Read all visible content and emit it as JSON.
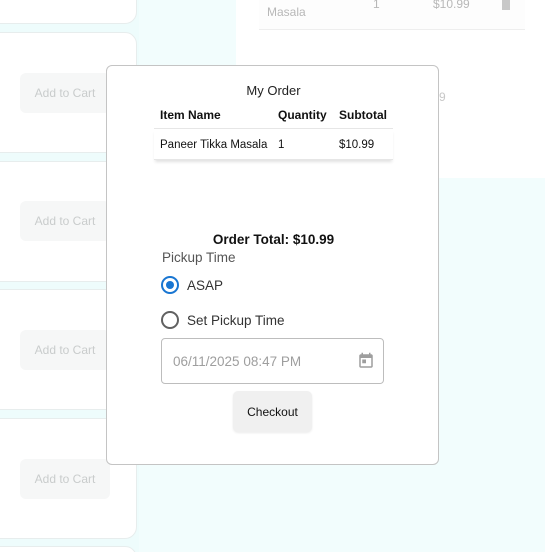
{
  "background": {
    "menu_cards": [
      {
        "add_label": "Add to Cart"
      },
      {
        "add_label": "Add to Cart"
      },
      {
        "add_label": "Add to Cart"
      },
      {
        "add_label": "Add to Cart"
      }
    ],
    "cart_row": {
      "name": "Masala",
      "quantity": "1",
      "price": "$10.99"
    },
    "cart_total_fragment": "9"
  },
  "modal": {
    "title": "My Order",
    "table": {
      "headers": [
        "Item Name",
        "Quantity",
        "Subtotal"
      ],
      "rows": [
        [
          "Paneer Tikka Masala",
          "1",
          "$10.99"
        ]
      ]
    },
    "order_total": "Order Total: $10.99",
    "pickup_label": "Pickup Time",
    "options": [
      {
        "label": "ASAP",
        "checked": true
      },
      {
        "label": "Set Pickup Time",
        "checked": false
      }
    ],
    "datetime_placeholder": "06/11/2025 08:47 PM",
    "checkout_label": "Checkout"
  },
  "colors": {
    "accent": "#1976d2",
    "background_tint": "#f2fdfd"
  }
}
